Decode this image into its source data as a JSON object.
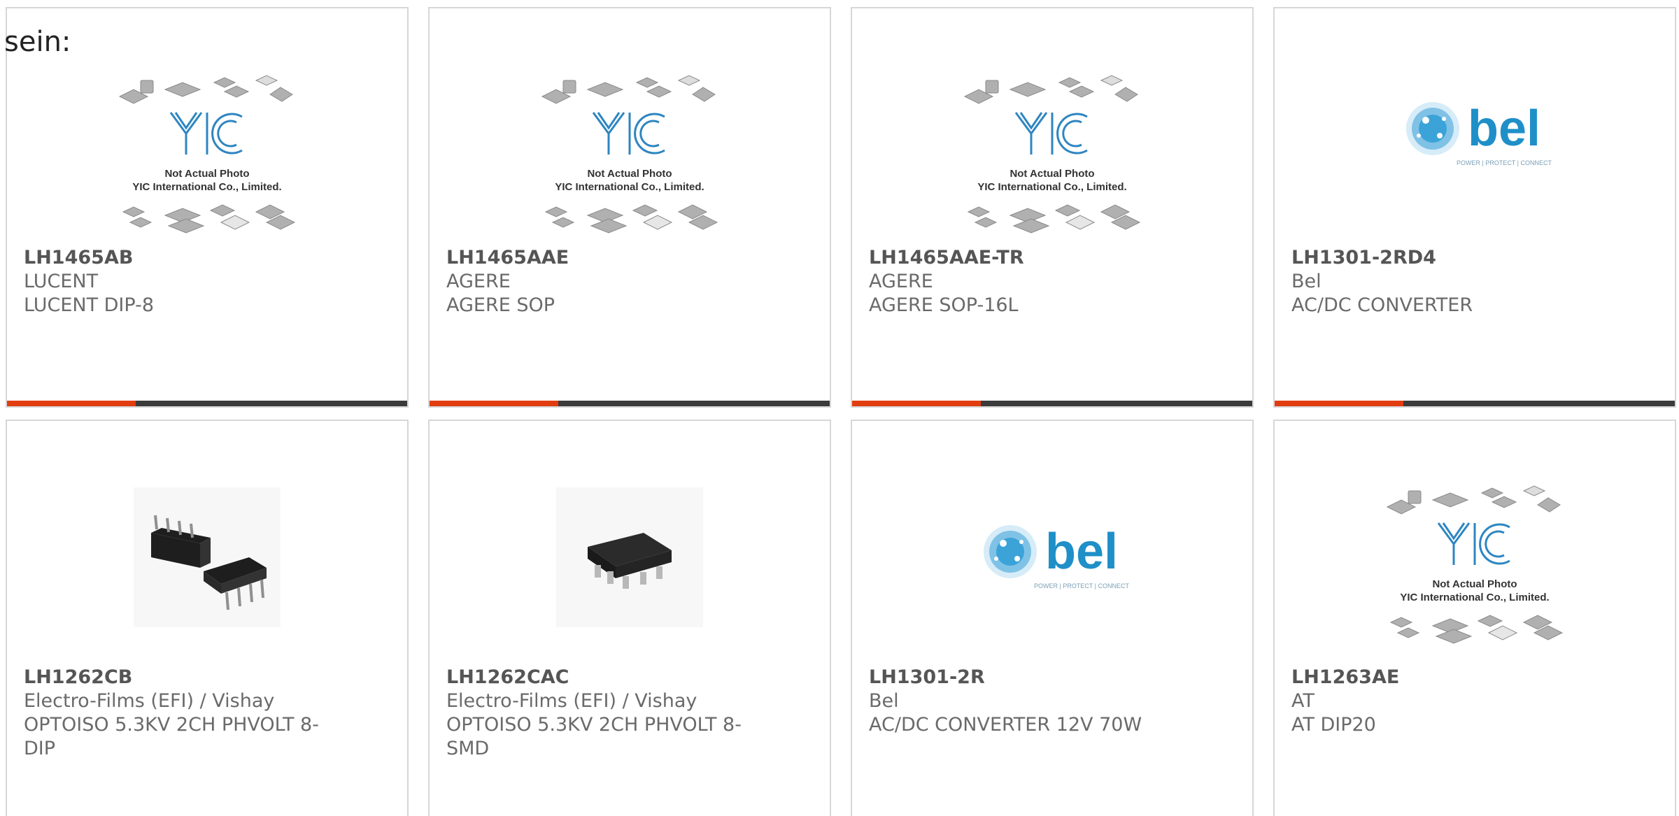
{
  "intro_text": "sein:",
  "brand_colors": {
    "accent": "#e23d10",
    "bar": "#3b3b3b",
    "bel_blue": "#1f8fc8",
    "yic_blue": "#2e86c1"
  },
  "placeholder_logo": {
    "line1": "Not Actual Photo",
    "line2": "YIC International Co., Limited.",
    "mark": "YIC"
  },
  "bel_logo": {
    "name": "bel",
    "tagline": "POWER | PROTECT | CONNECT"
  },
  "products": [
    {
      "part_number": "LH1465AB",
      "manufacturer": "LUCENT",
      "description": "LUCENT DIP-8",
      "image": "yic-placeholder"
    },
    {
      "part_number": "LH1465AAE",
      "manufacturer": "AGERE",
      "description": "AGERE SOP",
      "image": "yic-placeholder"
    },
    {
      "part_number": "LH1465AAE-TR",
      "manufacturer": "AGERE",
      "description": "AGERE SOP-16L",
      "image": "yic-placeholder"
    },
    {
      "part_number": "LH1301-2RD4",
      "manufacturer": "Bel",
      "description": "AC/DC CONVERTER",
      "image": "bel-logo"
    },
    {
      "part_number": "LH1262CB",
      "manufacturer": "Electro-Films (EFI) / Vishay",
      "description": "OPTOISO 5.3KV 2CH PHVOLT 8-DIP",
      "image": "dip-photo"
    },
    {
      "part_number": "LH1262CAC",
      "manufacturer": "Electro-Films (EFI) / Vishay",
      "description": "OPTOISO 5.3KV 2CH PHVOLT 8-SMD",
      "image": "smd-photo"
    },
    {
      "part_number": "LH1301-2R",
      "manufacturer": "Bel",
      "description": "AC/DC CONVERTER 12V 70W",
      "image": "bel-logo"
    },
    {
      "part_number": "LH1263AE",
      "manufacturer": "AT",
      "description": "AT DIP20",
      "image": "yic-placeholder"
    }
  ]
}
